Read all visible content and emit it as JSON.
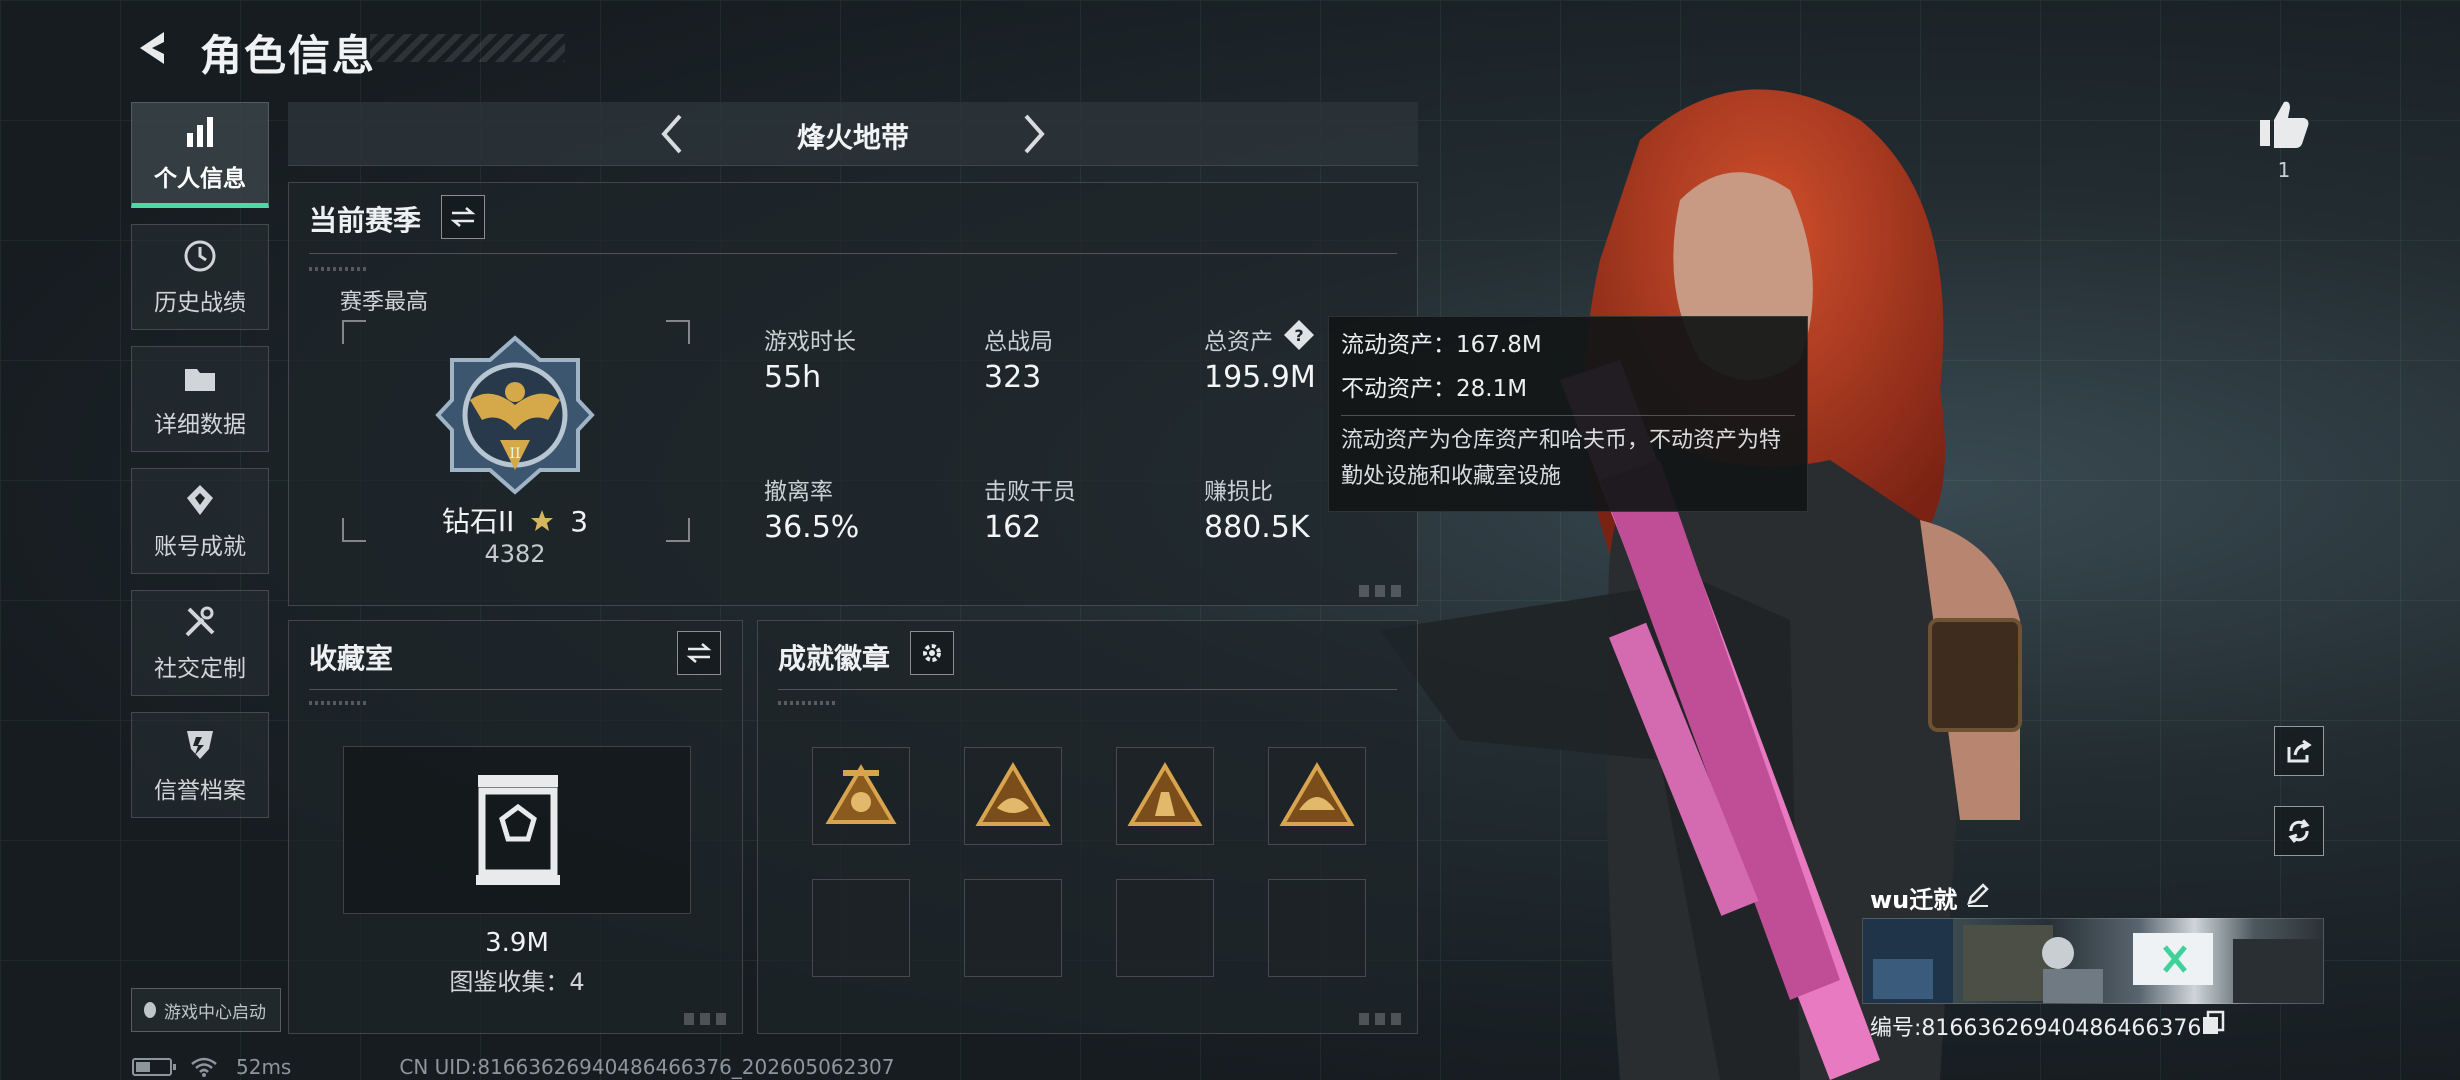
{
  "header": {
    "title": "角色信息"
  },
  "sidebar": {
    "items": [
      {
        "label": "个人信息",
        "icon": "bar-chart-icon",
        "active": true
      },
      {
        "label": "历史战绩",
        "icon": "clock-icon",
        "active": false
      },
      {
        "label": "详细数据",
        "icon": "folder-icon",
        "active": false
      },
      {
        "label": "账号成就",
        "icon": "achievement-icon",
        "active": false
      },
      {
        "label": "社交定制",
        "icon": "tools-icon",
        "active": false
      },
      {
        "label": "信誉档案",
        "icon": "shield-icon",
        "active": false
      }
    ],
    "game_center": "游戏中心启动"
  },
  "mode": {
    "title": "烽火地带"
  },
  "season": {
    "title": "当前赛季",
    "best_label": "赛季最高",
    "rank_name": "钻石II",
    "rank_stars": "3",
    "rank_score": "4382",
    "stats": [
      {
        "label": "游戏时长",
        "value": "55h"
      },
      {
        "label": "总战局",
        "value": "323"
      },
      {
        "label": "总资产",
        "value": "195.9M"
      },
      {
        "label": "撤离率",
        "value": "36.5%"
      },
      {
        "label": "击败干员",
        "value": "162"
      },
      {
        "label": "赚损比",
        "value": "880.5K"
      }
    ]
  },
  "tooltip": {
    "liquid": "流动资产：167.8M",
    "fixed": "不动资产：28.1M",
    "desc": "流动资产为仓库资产和哈夫币，不动资产为特勤处设施和收藏室设施"
  },
  "vault": {
    "title": "收藏室",
    "value": "3.9M",
    "collection": "图鉴收集：4"
  },
  "badges": {
    "title": "成就徽章"
  },
  "profile": {
    "likes": "1",
    "name": "wu迁就",
    "uid_label": "编号:8166362694048646637​6"
  },
  "status": {
    "ping": "52ms",
    "uid": "CN UID:8166362694048646637​6_202605062307"
  },
  "colors": {
    "accent": "#4fd9a6",
    "gold": "#c8a15a"
  }
}
